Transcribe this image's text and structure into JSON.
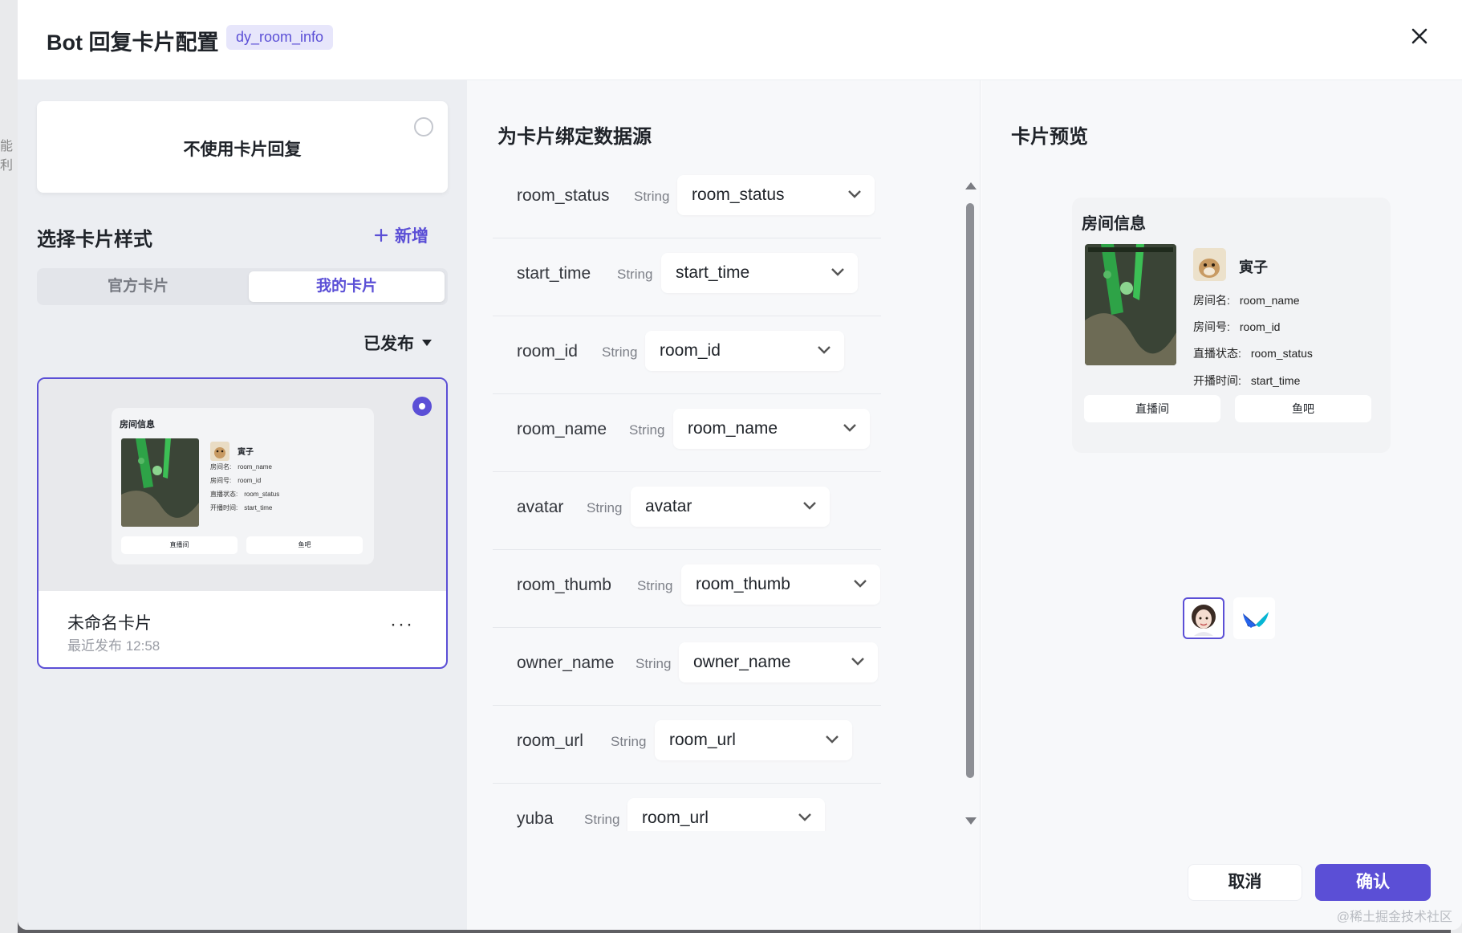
{
  "backdrop": {
    "left_fragment": "能利"
  },
  "header": {
    "title": "Bot 回复卡片配置",
    "tag": "dy_room_info",
    "close_icon": "close-icon"
  },
  "left": {
    "no_card_label": "不使用卡片回复",
    "select_title": "选择卡片样式",
    "add_label": "新增",
    "tabs": [
      {
        "label": "官方卡片",
        "active": false
      },
      {
        "label": "我的卡片",
        "active": true
      }
    ],
    "filter_label": "已发布",
    "style_card": {
      "name": "未命名卡片",
      "published_time": "最近发布 12:58",
      "more": "···",
      "mini": {
        "title": "房间信息",
        "owner": "寅子",
        "rows": [
          {
            "key": "房间名:",
            "value": "room_name"
          },
          {
            "key": "房间号:",
            "value": "room_id"
          },
          {
            "key": "直播状态:",
            "value": "room_status"
          },
          {
            "key": "开播时间:",
            "value": "start_time"
          }
        ],
        "buttons": [
          "直播间",
          "鱼吧"
        ]
      }
    }
  },
  "middle": {
    "title": "为卡片绑定数据源",
    "bindings": [
      {
        "field": "room_status",
        "type": "String",
        "value": "room_status"
      },
      {
        "field": "start_time",
        "type": "String",
        "value": "start_time"
      },
      {
        "field": "room_id",
        "type": "String",
        "value": "room_id"
      },
      {
        "field": "room_name",
        "type": "String",
        "value": "room_name"
      },
      {
        "field": "avatar",
        "type": "String",
        "value": "avatar"
      },
      {
        "field": "room_thumb",
        "type": "String",
        "value": "room_thumb"
      },
      {
        "field": "owner_name",
        "type": "String",
        "value": "owner_name"
      },
      {
        "field": "room_url",
        "type": "String",
        "value": "room_url"
      },
      {
        "field": "yuba",
        "type": "String",
        "value": "room_url"
      }
    ]
  },
  "right": {
    "title": "卡片预览",
    "card": {
      "title": "房间信息",
      "owner": "寅子",
      "rows": [
        {
          "key": "房间名:",
          "value": "room_name"
        },
        {
          "key": "房间号:",
          "value": "room_id"
        },
        {
          "key": "直播状态:",
          "value": "room_status"
        },
        {
          "key": "开播时间:",
          "value": "start_time"
        }
      ],
      "buttons": [
        "直播间",
        "鱼吧"
      ]
    },
    "switchers": [
      {
        "icon": "avatar-girl-icon",
        "active": true
      },
      {
        "icon": "feishu-bird-icon",
        "active": false
      }
    ]
  },
  "footer": {
    "cancel_label": "取消",
    "confirm_label": "确认"
  },
  "watermark": "@稀土掘金技术社区",
  "colors": {
    "accent": "#5b4fd6",
    "tag_bg": "#e7e6fb",
    "panel_left": "#eceef2",
    "panel_mid": "#f7f8fa"
  }
}
